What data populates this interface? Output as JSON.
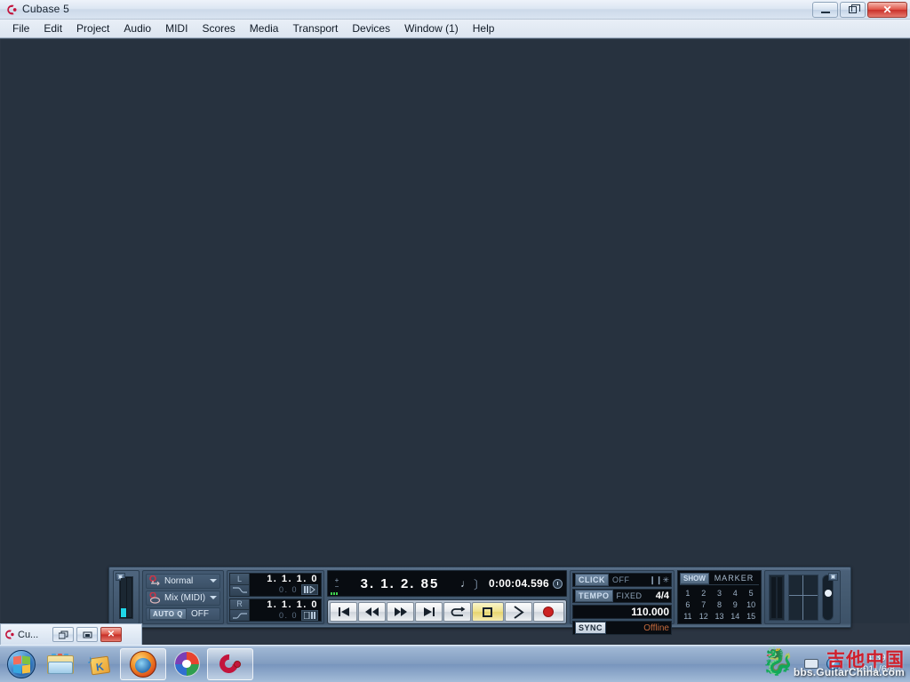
{
  "window": {
    "title": "Cubase 5",
    "icon": "cubase-logo-icon",
    "minimize_label": "",
    "maximize_label": "",
    "close_label": "✕"
  },
  "menubar": {
    "items": [
      {
        "label": "File"
      },
      {
        "label": "Edit"
      },
      {
        "label": "Project"
      },
      {
        "label": "Audio"
      },
      {
        "label": "MIDI"
      },
      {
        "label": "Scores"
      },
      {
        "label": "Media"
      },
      {
        "label": "Transport"
      },
      {
        "label": "Devices"
      },
      {
        "label": "Window (1)"
      },
      {
        "label": "Help"
      }
    ]
  },
  "transport": {
    "performance": {
      "hide_tab": "▣"
    },
    "record_mode": {
      "linear_mode": "Normal",
      "cycle_mode": "Mix (MIDI)",
      "auto_q_badge": "AUTO Q",
      "auto_q_value": "OFF"
    },
    "locators": {
      "left": {
        "tag": "L",
        "main": "1. 1. 1.  0",
        "sub": "0.     0"
      },
      "right": {
        "tag": "R",
        "main": "1. 1. 1.  0",
        "sub": "0.     0"
      }
    },
    "position": {
      "primary": "3. 1. 2. 85",
      "note_glyph": "♩",
      "secondary_time": "0:00:04.596"
    },
    "buttons": [
      {
        "name": "go-to-start",
        "glyph": "|◀"
      },
      {
        "name": "rewind",
        "glyph": "◀◀"
      },
      {
        "name": "forward",
        "glyph": "▶▶"
      },
      {
        "name": "go-to-end",
        "glyph": "▶|"
      },
      {
        "name": "cycle",
        "glyph": "⟲"
      },
      {
        "name": "stop",
        "glyph": "■"
      },
      {
        "name": "play",
        "glyph": "▶"
      },
      {
        "name": "record",
        "glyph": "●"
      }
    ],
    "click": {
      "tag": "CLICK",
      "value": "OFF",
      "precount_glyph": "❙❙✳"
    },
    "tempo": {
      "tag": "TEMPO",
      "mode": "FIXED",
      "signature": "4/4",
      "value": "110.000"
    },
    "sync": {
      "tag": "SYNC",
      "value": "Offline"
    },
    "markers": {
      "show_label": "SHOW",
      "title": "MARKER",
      "numbers": [
        "1",
        "2",
        "3",
        "4",
        "5",
        "6",
        "7",
        "8",
        "9",
        "10",
        "11",
        "12",
        "13",
        "14",
        "15"
      ]
    },
    "right_meters": {
      "hide_tab": "▣"
    }
  },
  "mdi_strip": {
    "label": "Cu...",
    "restore_glyph": "❐",
    "minimize_glyph": "▭",
    "close_glyph": "✕"
  },
  "taskbar": {
    "start_tooltip": "Start",
    "items": [
      {
        "name": "windows-explorer-icon",
        "label": "Windows Explorer"
      },
      {
        "name": "media-package-icon",
        "label": "Media"
      },
      {
        "name": "firefox-icon",
        "label": "Mozilla Firefox"
      },
      {
        "name": "picasa-icon",
        "label": "Picasa"
      },
      {
        "name": "cubase-icon",
        "label": "Cubase 5"
      }
    ],
    "tray": {
      "keyboard_icon": "keyboard-icon",
      "help_icon": "?",
      "clock_time": "4:39",
      "clock_date": "2011/6/8"
    }
  },
  "watermark": {
    "chinese": "吉他中国",
    "url": "bbs.GuitarChina.com"
  }
}
